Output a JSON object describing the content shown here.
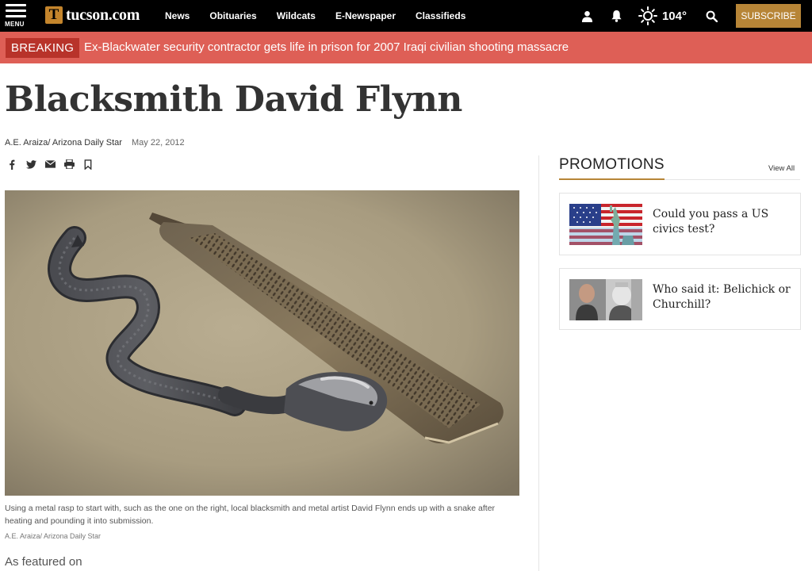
{
  "header": {
    "menu_label": "MENU",
    "logo_mark": "T",
    "logo_name": "tucson",
    "logo_tld": ".com",
    "nav": [
      "News",
      "Obituaries",
      "Wildcats",
      "E-Newspaper",
      "Classifieds"
    ],
    "weather_temp": "104°",
    "subscribe_label": "SUBSCRIBE",
    "accent_color": "#b78537"
  },
  "breaking": {
    "tag": "BREAKING",
    "headline": "Ex-Blackwater security contractor gets life in prison for 2007 Iraqi civilian shooting massacre",
    "color": "#de5f56"
  },
  "article": {
    "title": "Blacksmith David Flynn",
    "author": "A.E. Araiza/ Arizona Daily Star",
    "date": "May 22, 2012",
    "share_icons": [
      "facebook-icon",
      "twitter-icon",
      "email-icon",
      "print-icon",
      "bookmark-icon"
    ],
    "caption": "Using a metal rasp to start with, such as the one on the right, local blacksmith and metal artist David Flynn ends up with a snake after heating and pounding it into submission.",
    "photo_credit": "A.E. Araiza/ Arizona Daily Star",
    "featured_heading": "As featured on"
  },
  "sidebar": {
    "heading": "PROMOTIONS",
    "view_all": "View All",
    "promos": [
      {
        "text": "Could you pass a US civics test?",
        "thumb": "flag-statue-of-liberty-image"
      },
      {
        "text": "Who said it: Belichick or Churchill?",
        "thumb": "belichick-churchill-image"
      }
    ]
  }
}
